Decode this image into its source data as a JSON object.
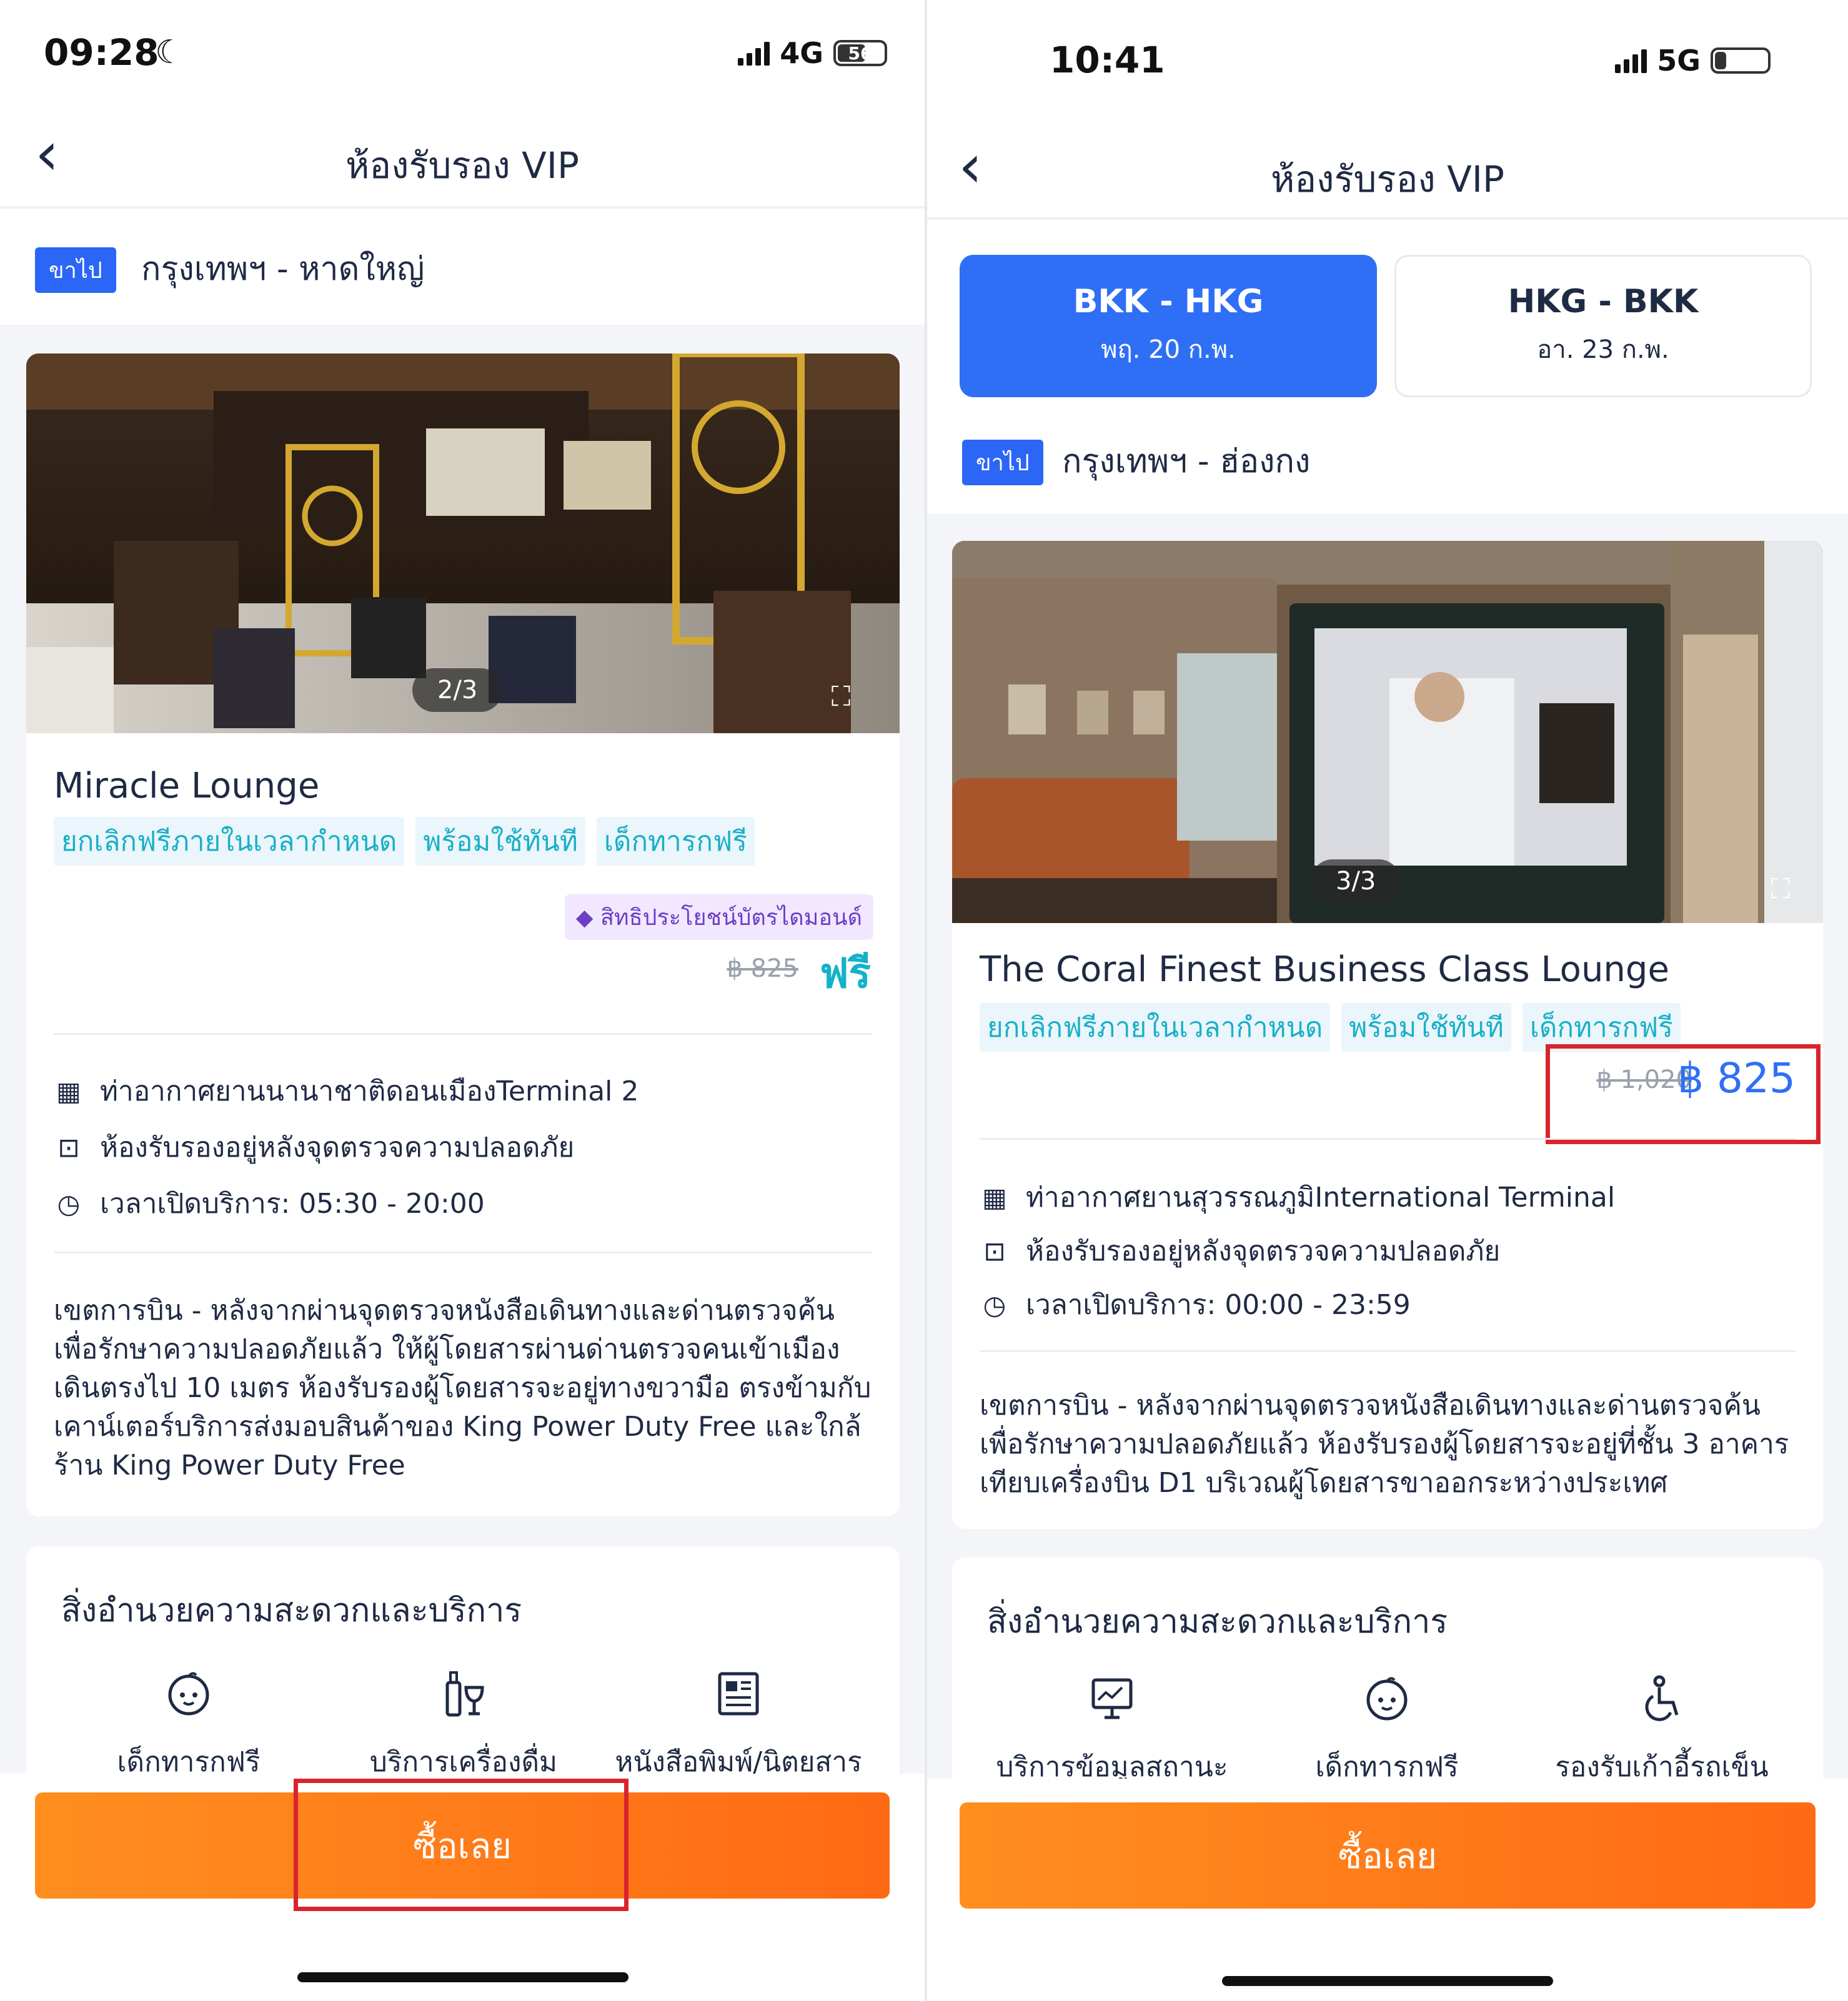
{
  "left": {
    "status": {
      "time": "09:28",
      "network": "4G",
      "battery": "56"
    },
    "nav": {
      "title": "ห้องรับรอง VIP"
    },
    "route": {
      "tag": "ขาไป",
      "text": "กรุงเทพฯ - หาดใหญ่"
    },
    "photo_counter": "2/3",
    "lounge_name": "Miracle Lounge",
    "tags": [
      "ยกเลิกฟรีภายในเวลากำหนด",
      "พร้อมใช้ทันที",
      "เด็กทารกฟรี"
    ],
    "diamond_benefit": "สิทธิประโยชน์บัตรไดมอนด์",
    "old_price": "฿ 825",
    "new_price": "ฟรี",
    "info": {
      "airport": "ท่าอากาศยานนานาชาติดอนเมืองTerminal 2",
      "location": "ห้องรับรองอยู่หลังจุดตรวจความปลอดภัย",
      "hours": "เวลาเปิดบริการ: 05:30 - 20:00"
    },
    "description": "เขตการบิน - หลังจากผ่านจุดตรวจหนังสือเดินทางและด่านตรวจค้นเพื่อรักษาความปลอดภัยแล้ว ให้ผู้โดยสารผ่านด่านตรวจคนเข้าเมือง เดินตรงไป 10 เมตร ห้องรับรองผู้โดยสารจะอยู่ทางขวามือ ตรงข้ามกับเคาน์เตอร์บริการส่งมอบสินค้าของ King Power Duty Free และใกล้ร้าน King Power Duty Free",
    "amenities_title": "สิ่งอำนวยความสะดวกและบริการ",
    "amenities": [
      "เด็กทารกฟรี",
      "บริการเครื่องดื่ม",
      "หนังสือพิมพ์/นิตยสาร"
    ],
    "buy_label": "ซื้อเลย"
  },
  "right": {
    "status": {
      "time": "10:41",
      "network": "5G"
    },
    "nav": {
      "title": "ห้องรับรอง VIP"
    },
    "tabs": [
      {
        "code": "BKK - HKG",
        "date": "พฤ. 20 ก.พ."
      },
      {
        "code": "HKG - BKK",
        "date": "อา. 23 ก.พ."
      }
    ],
    "route": {
      "tag": "ขาไป",
      "text": "กรุงเทพฯ - ฮ่องกง"
    },
    "photo_counter": "3/3",
    "lounge_name": "The Coral Finest Business Class Lounge",
    "tags": [
      "ยกเลิกฟรีภายในเวลากำหนด",
      "พร้อมใช้ทันที",
      "เด็กทารกฟรี"
    ],
    "old_price": "฿ 1,020",
    "new_price": "฿ 825",
    "info": {
      "airport": "ท่าอากาศยานสุวรรณภูมิInternational Terminal",
      "location": "ห้องรับรองอยู่หลังจุดตรวจความปลอดภัย",
      "hours": "เวลาเปิดบริการ: 00:00 - 23:59"
    },
    "description": "เขตการบิน - หลังจากผ่านจุดตรวจหนังสือเดินทางและด่านตรวจค้นเพื่อรักษาความปลอดภัยแล้ว ห้องรับรองผู้โดยสารจะอยู่ที่ชั้น 3 อาคารเทียบเครื่องบิน D1 บริเวณผู้โดยสารขาออกระหว่างประเทศ",
    "amenities_title": "สิ่งอำนวยความสะดวกและบริการ",
    "amenities": [
      "บริการข้อมูลสถานะ",
      "เด็กทารกฟรี",
      "รองรับเก้าอี้รถเข็น"
    ],
    "buy_label": "ซื้อเลย"
  }
}
